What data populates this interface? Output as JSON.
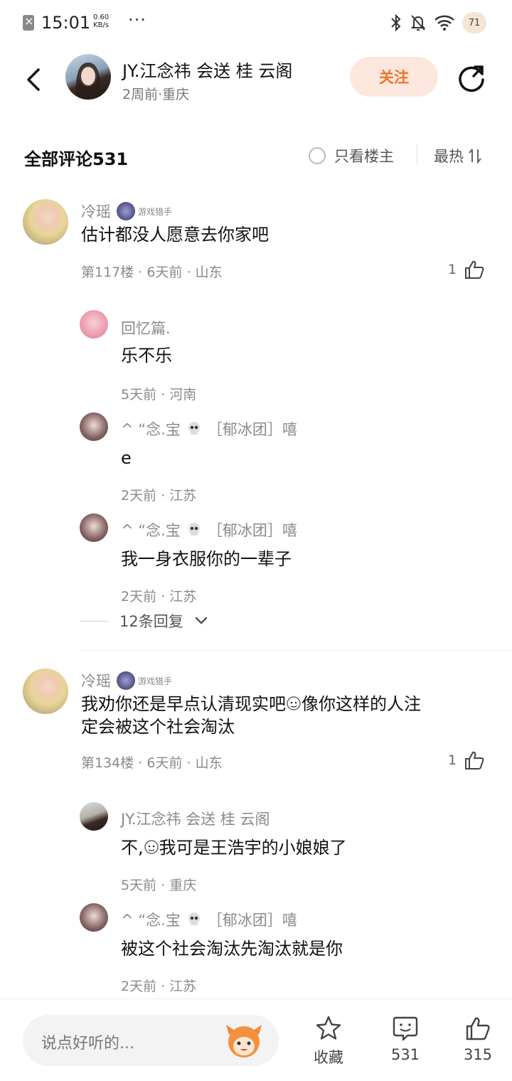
{
  "status_bar": {
    "time": "15:01",
    "net_speed_value": "0.60",
    "net_speed_unit": "KB/s",
    "more": "···",
    "battery": "71"
  },
  "header": {
    "author_name": "JY.江念祎 会送 桂 云阁",
    "author_meta": "2周前·重庆",
    "follow_label": "关注"
  },
  "comments_header": {
    "title": "全部评论531",
    "only_author_label": "只看楼主",
    "sort_label": "最热"
  },
  "comments": [
    {
      "nickname": "冷瑶",
      "badge": "游戏猎手",
      "text": "估计都没人愿意去你家吧",
      "meta": "第117楼 · 6天前 · 山东",
      "likes": "1",
      "replies": [
        {
          "nickname": "回忆篇.",
          "text": "乐不乐",
          "meta": "5天前 · 河南"
        },
        {
          "nickname": "^ “念.宝",
          "nickname_suffix": "［郁冰团］嘻",
          "text": "e",
          "meta": "2天前 · 江苏"
        },
        {
          "nickname": "^ “念.宝",
          "nickname_suffix": "［郁冰团］嘻",
          "text": "我一身衣服你的一辈子",
          "meta": "2天前 · 江苏"
        }
      ],
      "more_replies": "12条回复"
    },
    {
      "nickname": "冷瑶",
      "badge": "游戏猎手",
      "text_line1_a": "我劝你还是早点认清现实吧",
      "text_line1_b": "像你这样的人注",
      "text_line2": "定会被这个社会淘汰",
      "meta": "第134楼 · 6天前 · 山东",
      "likes": "1",
      "replies": [
        {
          "nickname": "JY.江念祎 会送 桂 云阁",
          "text_a": "不,",
          "text_b": "我可是王浩宇的小娘娘了",
          "meta": "5天前 · 重庆"
        },
        {
          "nickname": "^ “念.宝",
          "nickname_suffix": "［郁冰团］嘻",
          "text": "被这个社会淘汰先淘汰就是你",
          "meta": "2天前 · 江苏"
        }
      ]
    }
  ],
  "bottom_bar": {
    "input_placeholder": "说点好听的...",
    "favorite_label": "收藏",
    "comment_count": "531",
    "like_count": "315"
  },
  "colors": {
    "accent": "#f0722e",
    "follow_bg": "#fde7dc"
  }
}
